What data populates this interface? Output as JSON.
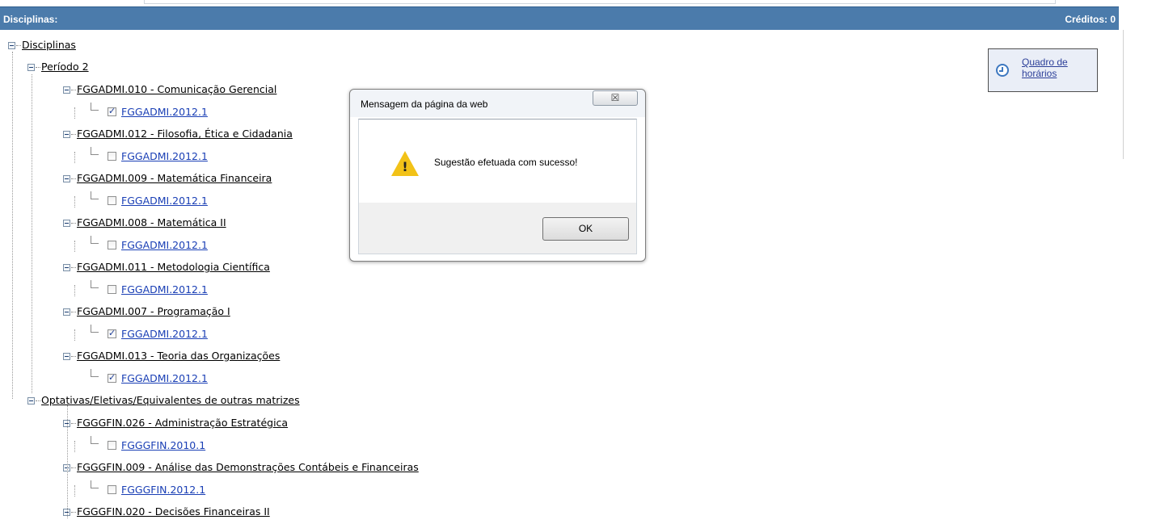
{
  "header": {
    "title": "Disciplinas:",
    "credits": "Créditos: 0"
  },
  "tree": {
    "root": "Disciplinas",
    "groups": [
      {
        "label": "Período 2",
        "courses": [
          {
            "label": "FGGADMI.010 - Comunicação Gerencial",
            "offer": "FGGADMI.2012.1",
            "checked": true
          },
          {
            "label": "FGGADMI.012 - Filosofia, Ética e Cidadania",
            "offer": "FGGADMI.2012.1",
            "checked": false
          },
          {
            "label": "FGGADMI.009 - Matemática Financeira",
            "offer": "FGGADMI.2012.1",
            "checked": false
          },
          {
            "label": "FGGADMI.008 - Matemática II",
            "offer": "FGGADMI.2012.1",
            "checked": false
          },
          {
            "label": "FGGADMI.011 - Metodologia Científica",
            "offer": "FGGADMI.2012.1",
            "checked": false
          },
          {
            "label": "FGGADMI.007 - Programação I",
            "offer": "FGGADMI.2012.1",
            "checked": true
          },
          {
            "label": "FGGADMI.013 - Teoria das Organizações",
            "offer": "FGGADMI.2012.1",
            "checked": true
          }
        ]
      },
      {
        "label": "Optativas/Eletivas/Equivalentes de outras matrizes",
        "courses": [
          {
            "label": "FGGGFIN.026 - Administração Estratégica",
            "offer": "FGGGFIN.2010.1",
            "checked": false
          },
          {
            "label": "FGGGFIN.009 - Análise das Demonstrações Contábeis e Financeiras",
            "offer": "FGGGFIN.2012.1",
            "checked": false
          },
          {
            "label": "FGGGFIN.020 - Decisões Financeiras II",
            "offer": "",
            "checked": false
          }
        ]
      }
    ]
  },
  "schedule_link": {
    "label": "Quadro de horários",
    "icon": "clock-icon"
  },
  "dialog": {
    "title": "Mensagem da página da web",
    "close": "☒",
    "message": "Sugestão efetuada com sucesso!",
    "ok": "OK",
    "icon": "warning-icon"
  },
  "colors": {
    "header": "#4b7bab",
    "link_offer": "#1a3fb5",
    "warning": "#f2c218"
  }
}
